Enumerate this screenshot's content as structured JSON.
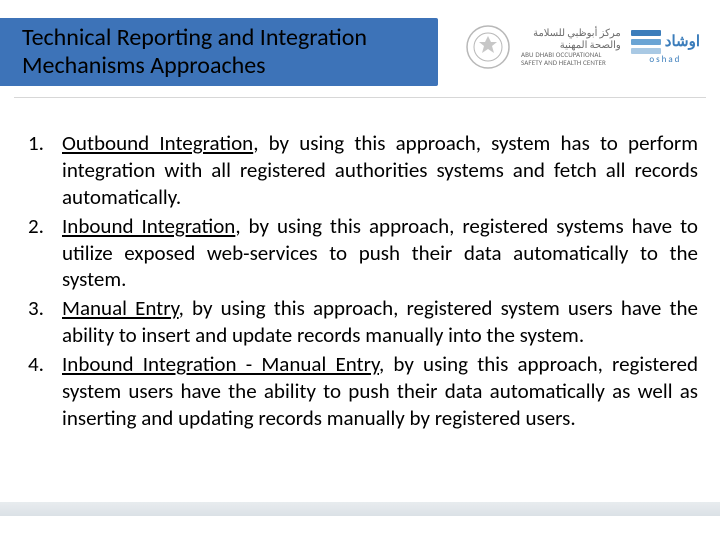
{
  "title": {
    "line1": "Technical Reporting and Integration",
    "line2": "Mechanisms Approaches"
  },
  "brand": {
    "arabic": "مركز أبوظبي للسلامة والصحة المهنية",
    "english": "ABU DHABI OCCUPATIONAL SAFETY AND HEALTH CENTER",
    "oshad_ar": "اوشاد",
    "oshad_en": "oshad"
  },
  "items": [
    {
      "num": "1.",
      "term": "Outbound Integration",
      "text": ", by using this approach, system has to perform integration with all registered authorities systems and fetch all records automatically."
    },
    {
      "num": "2.",
      "term": "Inbound Integration",
      "text": ", by using this approach, registered systems have to utilize exposed web-services to push their data automatically to the system."
    },
    {
      "num": "3.",
      "term": "Manual Entry",
      "text": ", by using this approach, registered system users have the ability to insert and update records manually into the system."
    },
    {
      "num": "4.",
      "term": "Inbound Integration - Manual Entry",
      "text": ", by using this approach, registered system users have the ability to push their data automatically as well as inserting and updating records manually by registered users."
    }
  ]
}
